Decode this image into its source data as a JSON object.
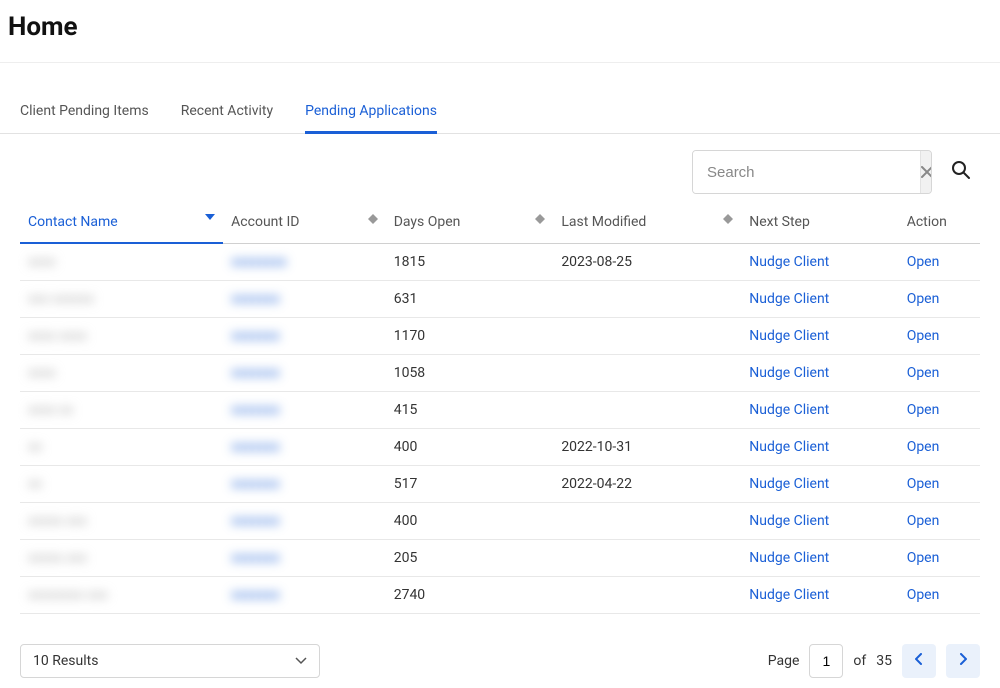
{
  "title": "Home",
  "tabs": [
    {
      "label": "Client Pending Items",
      "active": false
    },
    {
      "label": "Recent Activity",
      "active": false
    },
    {
      "label": "Pending Applications",
      "active": true
    }
  ],
  "search": {
    "placeholder": "Search",
    "value": ""
  },
  "columns": {
    "contact": "Contact Name",
    "account": "Account ID",
    "days": "Days Open",
    "last": "Last Modified",
    "next": "Next Step",
    "action": "Action"
  },
  "rows": [
    {
      "contact": "xxxx",
      "account": "xxxxxxxx",
      "days": "1815",
      "last": "2023-08-25",
      "next": "Nudge Client",
      "action": "Open"
    },
    {
      "contact": "xxx xxxxxx",
      "account": "xxxxxxx",
      "days": "631",
      "last": "",
      "next": "Nudge Client",
      "action": "Open"
    },
    {
      "contact": "xxxx xxxx",
      "account": "xxxxxxx",
      "days": "1170",
      "last": "",
      "next": "Nudge Client",
      "action": "Open"
    },
    {
      "contact": "xxxx",
      "account": "xxxxxxx",
      "days": "1058",
      "last": "",
      "next": "Nudge Client",
      "action": "Open"
    },
    {
      "contact": "xxxx xx",
      "account": "xxxxxxx",
      "days": "415",
      "last": "",
      "next": "Nudge Client",
      "action": "Open"
    },
    {
      "contact": "xx",
      "account": "xxxxxxx",
      "days": "400",
      "last": "2022-10-31",
      "next": "Nudge Client",
      "action": "Open"
    },
    {
      "contact": "xx",
      "account": "xxxxxxx",
      "days": "517",
      "last": "2022-04-22",
      "next": "Nudge Client",
      "action": "Open"
    },
    {
      "contact": "xxxxx xxx",
      "account": "xxxxxxx",
      "days": "400",
      "last": "",
      "next": "Nudge Client",
      "action": "Open"
    },
    {
      "contact": "xxxxx xxx",
      "account": "xxxxxxx",
      "days": "205",
      "last": "",
      "next": "Nudge Client",
      "action": "Open"
    },
    {
      "contact": "xxxxxxxx xxx",
      "account": "xxxxxxx",
      "days": "2740",
      "last": "",
      "next": "Nudge Client",
      "action": "Open"
    }
  ],
  "results_select": "10 Results",
  "pagination": {
    "page_label": "Page",
    "current": "1",
    "of_label": "of",
    "total": "35"
  }
}
